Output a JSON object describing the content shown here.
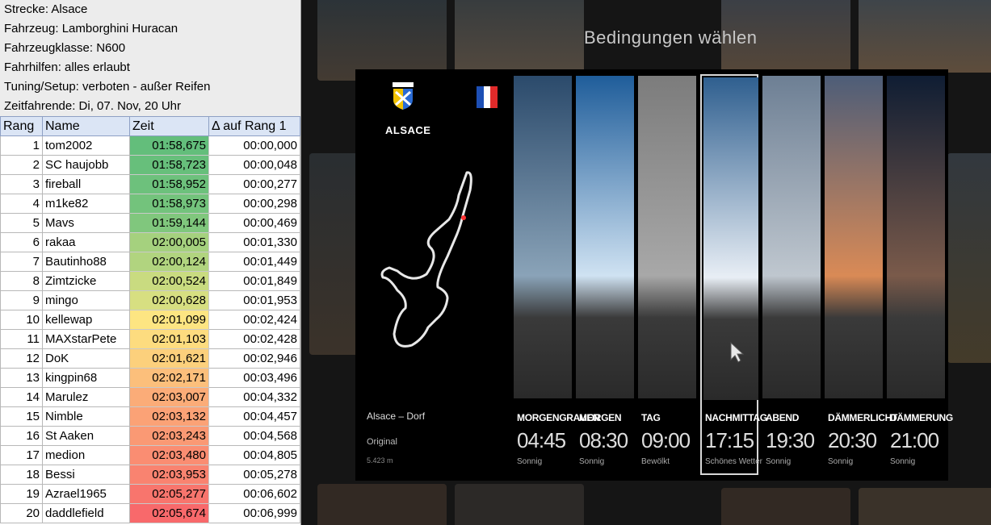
{
  "sheet": {
    "info": [
      "Strecke: Alsace",
      "Fahrzeug: Lamborghini Huracan",
      "Fahrzeugklasse: N600",
      "Fahrhilfen: alles erlaubt",
      "Tuning/Setup: verboten - außer Reifen",
      "Zeitfahrende: Di, 07. Nov, 20 Uhr"
    ],
    "headers": [
      "Rang",
      "Name",
      "Zeit",
      "Δ auf Rang 1"
    ],
    "rows": [
      {
        "rank": "1",
        "name": "tom2002",
        "time": "01:58,675",
        "delta": "00:00,000",
        "color": "#63be7b"
      },
      {
        "rank": "2",
        "name": "SC haujobb",
        "time": "01:58,723",
        "delta": "00:00,048",
        "color": "#67bf7b"
      },
      {
        "rank": "3",
        "name": "fireball",
        "time": "01:58,952",
        "delta": "00:00,277",
        "color": "#6dc17c"
      },
      {
        "rank": "4",
        "name": "m1ke82",
        "time": "01:58,973",
        "delta": "00:00,298",
        "color": "#73c37c"
      },
      {
        "rank": "5",
        "name": "Mavs",
        "time": "01:59,144",
        "delta": "00:00,469",
        "color": "#80c77d"
      },
      {
        "rank": "6",
        "name": "rakaa",
        "time": "02:00,005",
        "delta": "00:01,330",
        "color": "#a5d17e"
      },
      {
        "rank": "7",
        "name": "Bautinho88",
        "time": "02:00,124",
        "delta": "00:01,449",
        "color": "#b1d47f"
      },
      {
        "rank": "8",
        "name": "Zimtzicke",
        "time": "02:00,524",
        "delta": "00:01,849",
        "color": "#c9db80"
      },
      {
        "rank": "9",
        "name": "mingo",
        "time": "02:00,628",
        "delta": "00:01,953",
        "color": "#d7df81"
      },
      {
        "rank": "10",
        "name": "kellewap",
        "time": "02:01,099",
        "delta": "00:02,424",
        "color": "#fde582"
      },
      {
        "rank": "11",
        "name": "MAXstarPete",
        "time": "02:01,103",
        "delta": "00:02,428",
        "color": "#fddc7f"
      },
      {
        "rank": "12",
        "name": "DoK",
        "time": "02:01,621",
        "delta": "00:02,946",
        "color": "#fcd07c"
      },
      {
        "rank": "13",
        "name": "kingpin68",
        "time": "02:02,171",
        "delta": "00:03,496",
        "color": "#fcbf7b"
      },
      {
        "rank": "14",
        "name": "Marulez",
        "time": "02:03,007",
        "delta": "00:04,332",
        "color": "#fbac78"
      },
      {
        "rank": "15",
        "name": "Nimble",
        "time": "02:03,132",
        "delta": "00:04,457",
        "color": "#fba276"
      },
      {
        "rank": "16",
        "name": "St Aaken",
        "time": "02:03,243",
        "delta": "00:04,568",
        "color": "#fa9974"
      },
      {
        "rank": "17",
        "name": "medion",
        "time": "02:03,480",
        "delta": "00:04,805",
        "color": "#fa8d72"
      },
      {
        "rank": "18",
        "name": "Bessi",
        "time": "02:03,953",
        "delta": "00:05,278",
        "color": "#f98370"
      },
      {
        "rank": "19",
        "name": "Azrael1965",
        "time": "02:05,277",
        "delta": "00:06,602",
        "color": "#f8756d"
      },
      {
        "rank": "20",
        "name": "daddlefield",
        "time": "02:05,674",
        "delta": "00:06,999",
        "color": "#f8696b"
      }
    ]
  },
  "game": {
    "title": "Bedingungen wählen",
    "track": {
      "logo_text": "ALSACE",
      "name": "Alsace – Dorf",
      "version": "Original",
      "length": "5.423 m"
    },
    "flag_colors": [
      "#1d4fb5",
      "#ffffff",
      "#e12a2a"
    ],
    "slots": [
      {
        "label": "MORGENGRAUEN",
        "time": "04:45",
        "weather": "Sonnig",
        "sky_top": "#2b4a6b",
        "sky_bottom": "#8aa3b8",
        "selected": false
      },
      {
        "label": "MORGEN",
        "time": "08:30",
        "weather": "Sonnig",
        "sky_top": "#1f5d9a",
        "sky_bottom": "#cfe2f2",
        "selected": false
      },
      {
        "label": "TAG",
        "time": "09:00",
        "weather": "Bewölkt",
        "sky_top": "#7c7c7c",
        "sky_bottom": "#a8a8a8",
        "selected": false
      },
      {
        "label": "NACHMITTAG",
        "time": "17:15",
        "weather": "Schönes Wetter",
        "sky_top": "#2f5f8f",
        "sky_bottom": "#e8eef5",
        "selected": true
      },
      {
        "label": "ABEND",
        "time": "19:30",
        "weather": "Sonnig",
        "sky_top": "#6d7f94",
        "sky_bottom": "#bfc7cf",
        "selected": false
      },
      {
        "label": "DÄMMERLICHT",
        "time": "20:30",
        "weather": "Sonnig",
        "sky_top": "#4d5d78",
        "sky_bottom": "#d98a56",
        "selected": false
      },
      {
        "label": "DÄMMERUNG",
        "time": "21:00",
        "weather": "Sonnig",
        "sky_top": "#0f1d33",
        "sky_bottom": "#7a5a4a",
        "selected": false
      }
    ]
  }
}
